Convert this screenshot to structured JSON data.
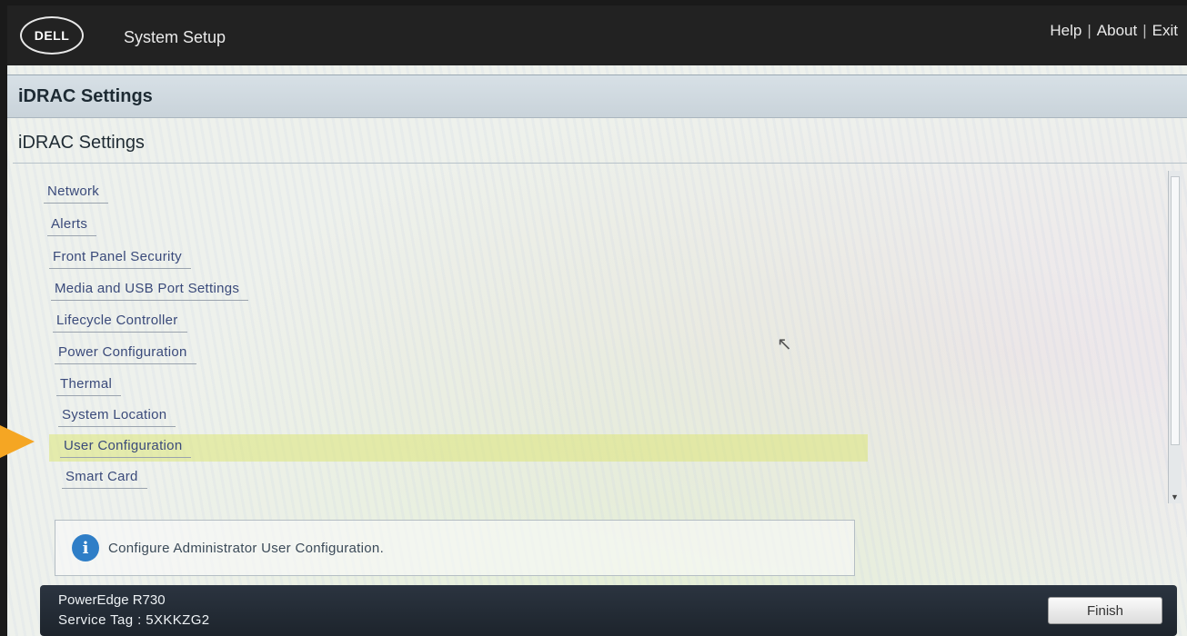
{
  "topbar": {
    "logo_text": "DELL",
    "app_title": "System Setup",
    "links": {
      "help": "Help",
      "about": "About",
      "exit": "Exit",
      "separator": "|"
    }
  },
  "page": {
    "title": "iDRAC Settings",
    "subtitle": "iDRAC Settings"
  },
  "menu": {
    "items": [
      {
        "label": "Network"
      },
      {
        "label": "Alerts"
      },
      {
        "label": "Front Panel Security"
      },
      {
        "label": "Media and USB Port Settings"
      },
      {
        "label": "Lifecycle Controller"
      },
      {
        "label": "Power Configuration"
      },
      {
        "label": "Thermal"
      },
      {
        "label": "System Location"
      },
      {
        "label": "User Configuration",
        "selected": true
      },
      {
        "label": "Smart Card"
      }
    ]
  },
  "help": {
    "icon": "info-icon",
    "text": "Configure Administrator User Configuration."
  },
  "footer": {
    "model": "PowerEdge R730",
    "service_tag": "Service Tag : 5XKKZG2",
    "finish_label": "Finish"
  },
  "colors": {
    "accent_arrow": "#f5a623",
    "selected_highlight": "#dce678",
    "info_icon": "#2f7ec7"
  }
}
